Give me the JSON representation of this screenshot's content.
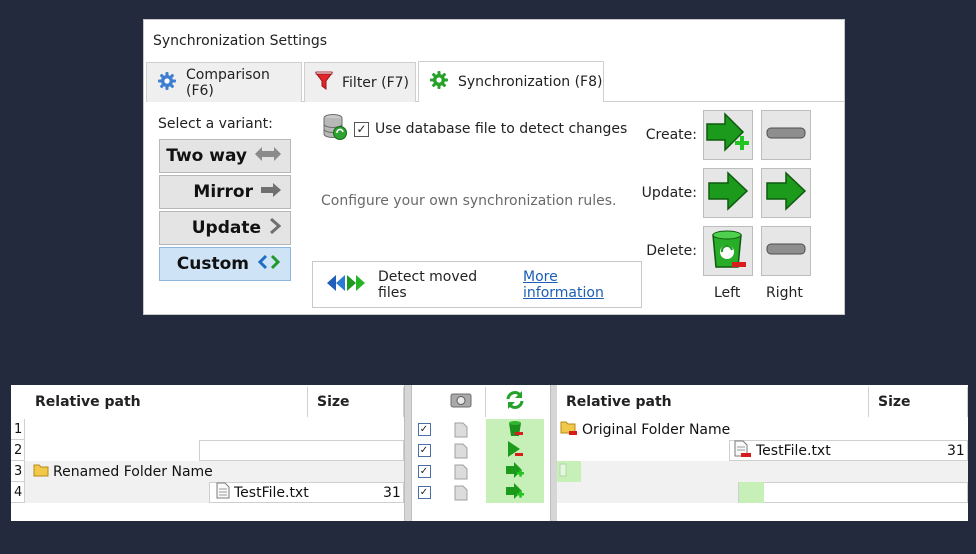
{
  "dialog": {
    "title": "Synchronization Settings",
    "tabs": [
      {
        "label": "Comparison (F6)",
        "icon": "gear-icon"
      },
      {
        "label": "Filter (F7)",
        "icon": "filter-icon"
      },
      {
        "label": "Synchronization (F8)",
        "icon": "sync-gear-icon"
      }
    ],
    "active_tab": "Synchronization (F8)",
    "variant_label": "Select a variant:",
    "variants": [
      {
        "label": "Two way",
        "icon": "two-way-arrow-icon"
      },
      {
        "label": "Mirror",
        "icon": "right-arrow-icon"
      },
      {
        "label": "Update",
        "icon": "chevron-right-icon"
      },
      {
        "label": "Custom",
        "icon": "custom-arrows-icon"
      }
    ],
    "selected_variant": "Custom",
    "database_checkbox_label": "Use database file to detect changes",
    "database_checked": true,
    "configure_text": "Configure your own synchronization rules.",
    "detect_moved_label": "Detect moved files",
    "more_info_link": "More information",
    "actions": {
      "create_label": "Create:",
      "update_label": "Update:",
      "delete_label": "Delete:",
      "left_label": "Left",
      "right_label": "Right"
    },
    "colors": {
      "accent_green": "#1e9a1e",
      "selected_blue": "#cfe3f7",
      "link": "#1a5fb4"
    }
  },
  "grid": {
    "left": {
      "headers": [
        "Relative path",
        "Size"
      ],
      "rows": [
        {
          "num": "1",
          "path": "",
          "size": ""
        },
        {
          "num": "2",
          "path": "",
          "size": ""
        },
        {
          "num": "3",
          "path": "Renamed Folder Name",
          "size": ""
        },
        {
          "num": "4",
          "path": "TestFile.txt",
          "size": "31"
        }
      ]
    },
    "right": {
      "headers": [
        "Relative path",
        "Size"
      ],
      "rows": [
        {
          "path": "Original Folder Name",
          "size": ""
        },
        {
          "path": "TestFile.txt",
          "size": "31"
        },
        {
          "path": "",
          "size": ""
        },
        {
          "path": "",
          "size": ""
        }
      ]
    },
    "middle": {
      "header_icons": [
        "compare-magnify-icon",
        "sync-arrows-icon"
      ],
      "rows_checked": [
        true,
        true,
        true,
        true
      ]
    }
  }
}
